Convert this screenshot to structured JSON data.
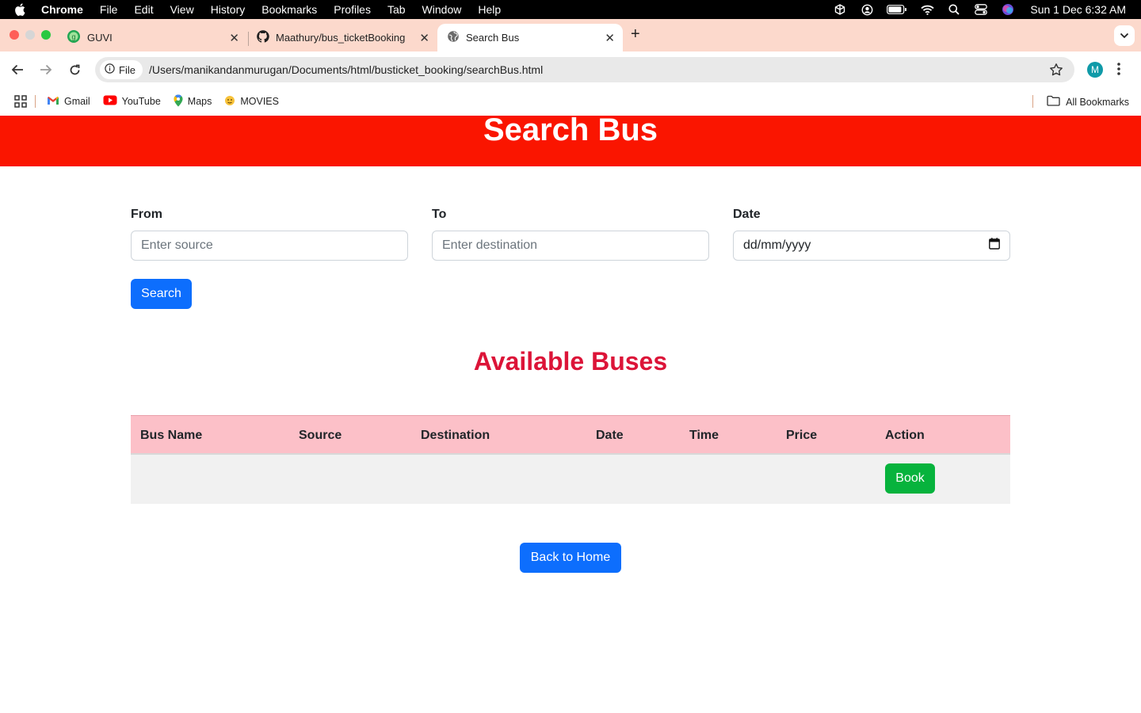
{
  "menubar": {
    "app": "Chrome",
    "items": [
      "File",
      "Edit",
      "View",
      "History",
      "Bookmarks",
      "Profiles",
      "Tab",
      "Window",
      "Help"
    ],
    "clock": "Sun 1 Dec  6:32 AM"
  },
  "tabs": [
    {
      "title": "GUVI",
      "icon": "guvi-icon"
    },
    {
      "title": "Maathury/bus_ticketBooking",
      "icon": "github-icon"
    },
    {
      "title": "Search Bus",
      "icon": "globe-icon",
      "active": true
    }
  ],
  "toolbar": {
    "file_chip": "File",
    "url": "/Users/manikandanmurugan/Documents/html/busticket_booking/searchBus.html",
    "profile_initial": "M"
  },
  "bookmarks": {
    "items": [
      "Gmail",
      "YouTube",
      "Maps",
      "MOVIES"
    ],
    "all_label": "All Bookmarks"
  },
  "page": {
    "title": "Search Bus",
    "form": {
      "from_label": "From",
      "from_placeholder": "Enter source",
      "to_label": "To",
      "to_placeholder": "Enter destination",
      "date_label": "Date",
      "date_placeholder": "dd/mm/yyyy",
      "search_button": "Search"
    },
    "results_title": "Available Buses",
    "table": {
      "columns": [
        "Bus Name",
        "Source",
        "Destination",
        "Date",
        "Time",
        "Price",
        "Action"
      ],
      "rows": [
        {
          "bus_name": "",
          "source": "",
          "destination": "",
          "date": "",
          "time": "",
          "price": "",
          "action": "Book"
        }
      ]
    },
    "back_button": "Back to Home"
  },
  "colors": {
    "header_bg": "#fa1500",
    "section_title": "#dc1438",
    "primary": "#0d6efd",
    "book_button": "#07b33d",
    "table_header": "#fcc0c8",
    "tabstrip": "#fcd9cc"
  }
}
